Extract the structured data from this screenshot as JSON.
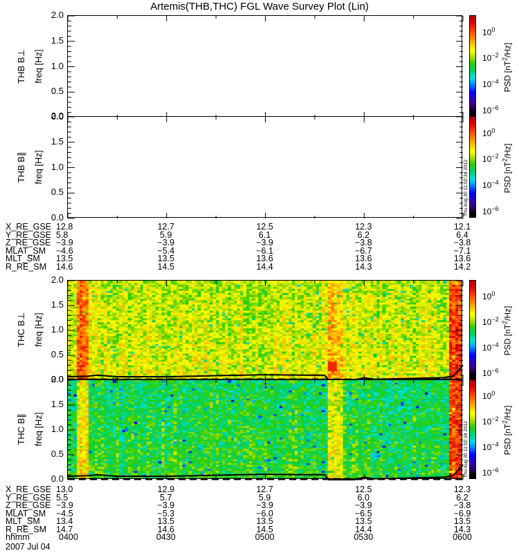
{
  "chart_data": {
    "type": "heatmap",
    "title": "Artemis(THB,THC) FGL Wave Survey Plot (Lin)",
    "xlabel": "hhmm",
    "date_label": "2007 Jul 04",
    "x_range_hours_ut": [
      4.0,
      6.0
    ],
    "x_tick_labels": [
      "0400",
      "0430",
      "0500",
      "0530",
      "0600"
    ],
    "y_tick_labels": [
      "0.0",
      "0.5",
      "1.0",
      "1.5",
      "2.0"
    ],
    "ylim": [
      0.0,
      2.0
    ],
    "colorbar": {
      "title": "PSD [nT²/Hz]",
      "title_parts": {
        "pre": "PSD [nT",
        "sup": "2",
        "post": "/Hz]"
      },
      "log10_range": [
        -6.6,
        1.2
      ],
      "ticks": [
        {
          "base": "10",
          "exp": "0",
          "value": 0
        },
        {
          "base": "10",
          "exp": "−2",
          "value": -2
        },
        {
          "base": "10",
          "exp": "−4",
          "value": -4
        },
        {
          "base": "10",
          "exp": "−6",
          "value": -6
        }
      ],
      "colormap": "rainbow (black-purple-blue-cyan-green-yellow-red)"
    },
    "timestamp": "Thu Aug 30 11:02:34 2012",
    "panels": [
      {
        "id": "thb-bperp",
        "label": "THB B⊥",
        "ylabel": "freq [Hz]",
        "has_data": false,
        "timestamp": false
      },
      {
        "id": "thb-bpar",
        "label": "THB B∥",
        "ylabel": "freq [Hz]",
        "has_data": false,
        "timestamp": true
      },
      {
        "id": "thc-bperp",
        "label": "THC B⊥",
        "ylabel": "freq [Hz]",
        "has_data": true,
        "timestamp": false,
        "psd_log10_median": -1.6,
        "enhanced_intervals_hours": [
          [
            4.05,
            4.11,
            0.0
          ],
          [
            5.33,
            5.4,
            -0.8
          ],
          [
            5.94,
            6.0,
            0.3
          ]
        ]
      },
      {
        "id": "thc-bpar",
        "label": "THC B∥",
        "ylabel": "freq [Hz]",
        "has_data": true,
        "timestamp": true,
        "psd_log10_median": -2.6,
        "enhanced_intervals_hours": [
          [
            4.05,
            4.11,
            -1.2
          ],
          [
            5.33,
            5.4,
            -1.5
          ],
          [
            5.94,
            6.0,
            0.2
          ]
        ]
      }
    ],
    "series": [
      {
        "name": "cutoff frequency (solid black line)",
        "x": [
          4.0,
          4.1,
          4.15,
          4.25,
          4.5,
          4.75,
          5.0,
          5.2,
          5.3,
          5.32,
          5.45,
          5.5,
          5.55,
          5.7,
          5.9,
          5.95,
          6.0
        ],
        "y": [
          0.07,
          0.08,
          0.1,
          0.07,
          0.07,
          0.09,
          0.11,
          0.1,
          0.1,
          0.0,
          0.0,
          0.05,
          0.02,
          0.03,
          0.05,
          0.08,
          0.3
        ]
      }
    ]
  },
  "ephemeris_top": {
    "rows": [
      {
        "label": "X_RE_GSE",
        "values": [
          "12.8",
          "12.7",
          "12.5",
          "12.3",
          "12.1"
        ]
      },
      {
        "label": "Y_RE_GSE",
        "values": [
          "5.8",
          "5.9",
          "6.1",
          "6.2",
          "6.4"
        ]
      },
      {
        "label": "Z_RE_GSE",
        "values": [
          "−3.9",
          "−3.9",
          "−3.9",
          "−3.8",
          "−3.8"
        ]
      },
      {
        "label": "MLAT_SM",
        "values": [
          "−4.6",
          "−5.4",
          "−6.1",
          "−6.7",
          "−7.1"
        ]
      },
      {
        "label": "MLT_SM",
        "values": [
          "13.5",
          "13.5",
          "13.6",
          "13.6",
          "13.6"
        ]
      },
      {
        "label": "R_RE_SM",
        "values": [
          "14.6",
          "14.5",
          "14.4",
          "14.3",
          "14.2"
        ]
      }
    ]
  },
  "ephemeris_bottom": {
    "rows": [
      {
        "label": "X_RE_GSE",
        "values": [
          "13.0",
          "12.9",
          "12.7",
          "12.5",
          "12.3"
        ]
      },
      {
        "label": "Y_RE_GSE",
        "values": [
          "5.5",
          "5.7",
          "5.9",
          "6.0",
          "6.2"
        ]
      },
      {
        "label": "Z_RE_GSE",
        "values": [
          "−3.9",
          "−3.9",
          "−3.9",
          "−3.9",
          "−3.8"
        ]
      },
      {
        "label": "MLAT_SM",
        "values": [
          "−4.5",
          "−5.3",
          "−6.0",
          "−6.5",
          "−6.9"
        ]
      },
      {
        "label": "MLT_SM",
        "values": [
          "13.4",
          "13.5",
          "13.5",
          "13.5",
          "13.5"
        ]
      },
      {
        "label": "R_RE_SM",
        "values": [
          "14.7",
          "14.6",
          "14.5",
          "14.4",
          "14.3"
        ]
      },
      {
        "label": "hhmm",
        "values": [
          "0400",
          "0430",
          "0500",
          "0530",
          "0600"
        ]
      }
    ]
  }
}
